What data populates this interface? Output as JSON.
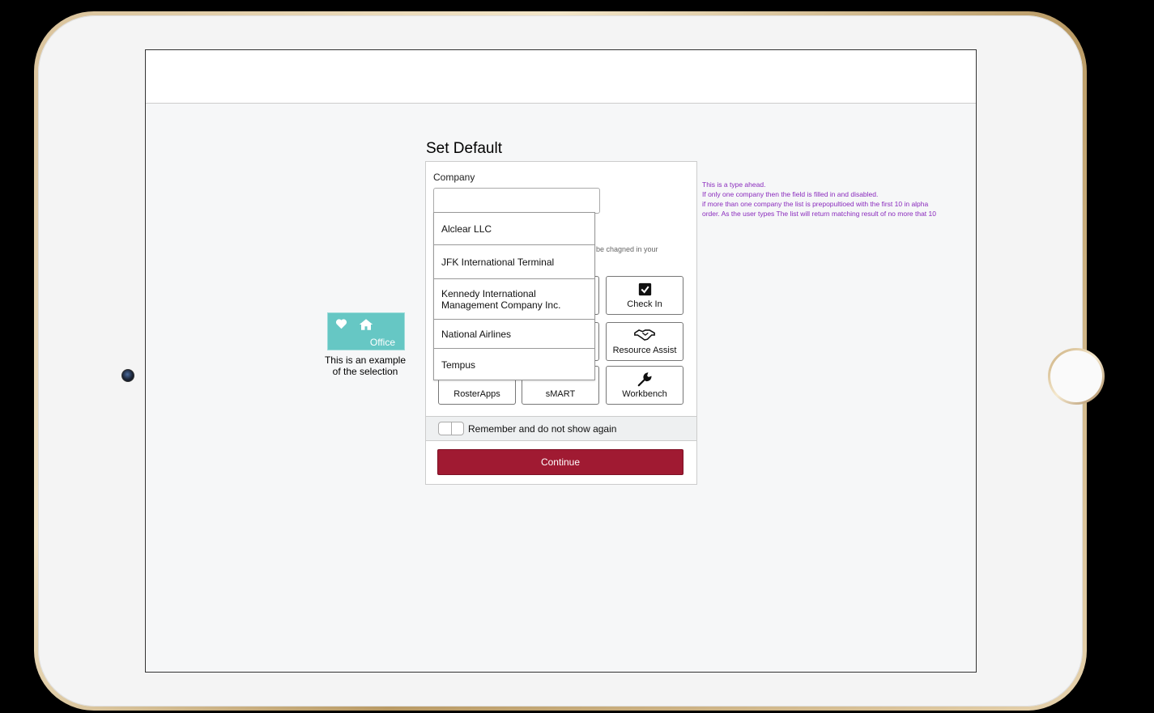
{
  "example": {
    "tile_label": "Office",
    "caption": "This is an example of the selection"
  },
  "dialog": {
    "title": "Set Default",
    "company_label": "Company",
    "company_value": "",
    "hint_visible": "be chagned in your",
    "tiles": [
      {
        "label": "Check In",
        "icon": "checkbox-icon"
      },
      {
        "label": "Resource Assist",
        "icon": "handshake-icon"
      },
      {
        "label": "RosterApps",
        "icon": "calendar-icon"
      },
      {
        "label": "sMART",
        "icon": "location-icon"
      },
      {
        "label": "Workbench",
        "icon": "wrench-icon"
      }
    ],
    "remember_label": "Remember and do not show again",
    "continue_label": "Continue"
  },
  "dropdown": {
    "items": [
      "Alclear LLC",
      "JFK International Terminal",
      "Kennedy International Management Company Inc.",
      "National Airlines",
      "Tempus"
    ]
  },
  "annotation": {
    "lines": [
      "This is a type ahead.",
      "If only one company then the field is filled in and disabled.",
      "if more than one company the list is prepopultioed with the first 10 in alpha",
      "order. As the user types The list will return matching result of no more that 10"
    ]
  },
  "colors": {
    "accent": "#a01a32",
    "tile_teal": "#66c7c4",
    "annotation": "#8a2bbd"
  }
}
